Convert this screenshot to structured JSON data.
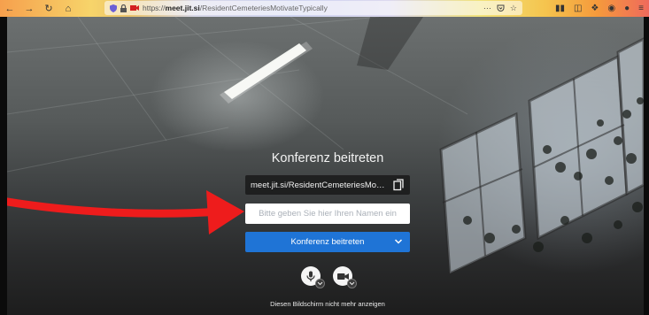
{
  "browser": {
    "url_host": "meet.jit.si",
    "url_rest": "/ResidentCemeteriesMotivateTypically",
    "url_prefix": "https://",
    "page_actions": "···"
  },
  "prejoin": {
    "title": "Konferenz beitreten",
    "meeting_url": "meet.jit.si/ResidentCemeteriesMotivateTypically",
    "name_placeholder": "Bitte geben Sie hier Ihren Namen ein",
    "name_value": "",
    "join_label": "Konferenz beitreten",
    "dont_show_again": "Diesen Bildschirm nicht mehr anzeigen"
  },
  "icons": {
    "back": "back-arrow-icon",
    "forward": "forward-arrow-icon",
    "reload": "reload-icon",
    "home": "home-icon",
    "shield": "shield-icon",
    "lock": "lock-icon",
    "camera_permission": "camera-permission-icon",
    "bookmark": "star-icon",
    "pocket": "pocket-icon",
    "copy": "copy-icon",
    "microphone": "microphone-icon",
    "camera": "camera-icon"
  },
  "colors": {
    "join_button": "#1f74d6",
    "annotation_arrow": "#ee1c1c"
  }
}
